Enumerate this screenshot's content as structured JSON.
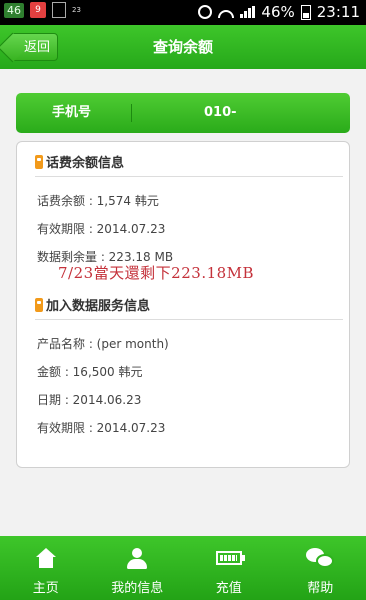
{
  "status_bar": {
    "left_badge": "46",
    "calendar_day": "9",
    "small_text": "23",
    "battery_percent": "46%",
    "time": "23:11"
  },
  "header": {
    "back_label": "返回",
    "title": "查询余额"
  },
  "phone": {
    "label": "手机号",
    "value": "010-"
  },
  "balance_section": {
    "title": "话费余额信息",
    "rows": [
      "话费余额 : 1,574 韩元",
      "有效期限 : 2014.07.23",
      "数据剩余量 : 223.18 MB"
    ]
  },
  "handwritten_note": "7/23當天還剩下223.18MB",
  "service_section": {
    "title": "加入数据服务信息",
    "rows": [
      "产品名称 : (per month)",
      "金额 : 16,500 韩元",
      "日期 : 2014.06.23",
      "有效期限 : 2014.07.23"
    ]
  },
  "bottom_nav": [
    {
      "label": "主页",
      "icon": "home-icon"
    },
    {
      "label": "我的信息",
      "icon": "user-icon"
    },
    {
      "label": "充值",
      "icon": "battery-icon"
    },
    {
      "label": "帮助",
      "icon": "chat-icon"
    }
  ],
  "colors": {
    "primary_green": "#2fb31f",
    "note_red": "#c4313a",
    "tag_orange": "#f29a1a"
  }
}
